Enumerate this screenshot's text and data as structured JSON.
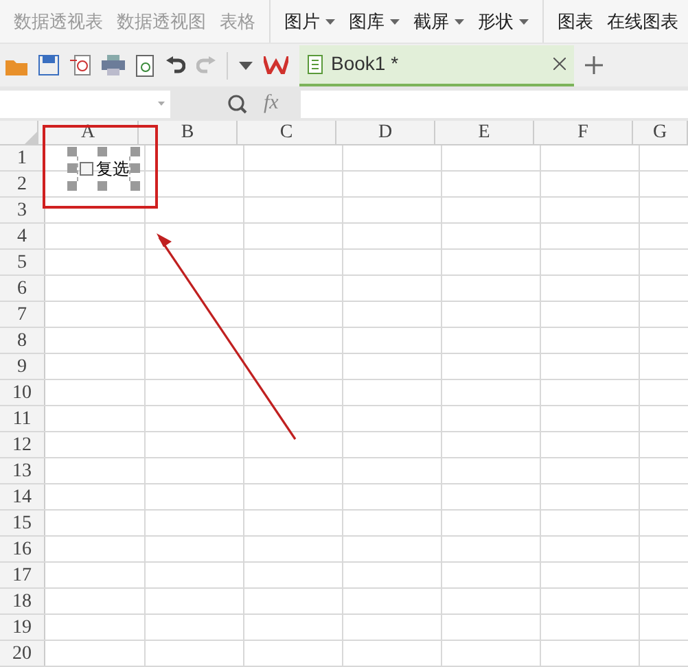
{
  "ribbon": [
    {
      "items": [
        {
          "label": "数据透视表",
          "dropdown": false,
          "disabled": true
        },
        {
          "label": "数据透视图",
          "dropdown": false,
          "disabled": true
        },
        {
          "label": "表格",
          "dropdown": false,
          "disabled": true
        }
      ]
    },
    {
      "items": [
        {
          "label": "图片",
          "dropdown": true,
          "disabled": false
        },
        {
          "label": "图库",
          "dropdown": true,
          "disabled": false
        },
        {
          "label": "截屏",
          "dropdown": true,
          "disabled": false
        },
        {
          "label": "形状",
          "dropdown": true,
          "disabled": false
        }
      ]
    },
    {
      "items": [
        {
          "label": "图表",
          "dropdown": false,
          "disabled": false
        },
        {
          "label": "在线图表",
          "dropdown": false,
          "disabled": false
        }
      ]
    }
  ],
  "document_tab": {
    "title": "Book1 *",
    "selected": true
  },
  "formula_bar": {
    "fx": "fx"
  },
  "columns": [
    "A",
    "B",
    "C",
    "D",
    "E",
    "F",
    "G"
  ],
  "rows": [
    "1",
    "2",
    "3",
    "4",
    "5",
    "6",
    "7",
    "8",
    "9",
    "10",
    "11",
    "12",
    "13",
    "14",
    "15",
    "16",
    "17",
    "18",
    "19",
    "20"
  ],
  "checkbox": {
    "label": "复选",
    "checked": false
  }
}
